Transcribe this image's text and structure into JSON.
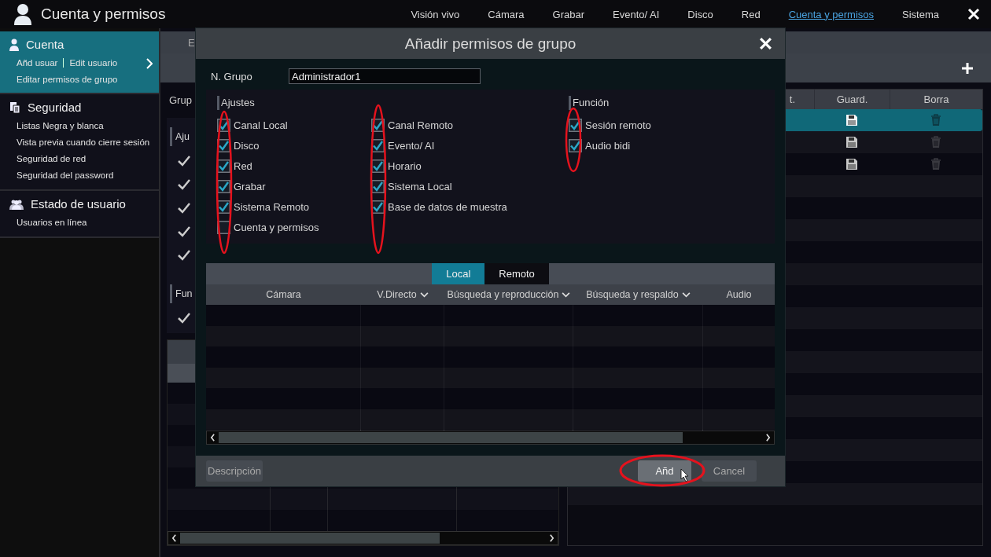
{
  "app": {
    "title": "Cuenta y permisos"
  },
  "nav": [
    {
      "label": "Visión vivo",
      "selected": false
    },
    {
      "label": "Cámara",
      "selected": false
    },
    {
      "label": "Grabar",
      "selected": false
    },
    {
      "label": "Evento/ AI",
      "selected": false
    },
    {
      "label": "Disco",
      "selected": false
    },
    {
      "label": "Red",
      "selected": false
    },
    {
      "label": "Cuenta y permisos",
      "selected": true
    },
    {
      "label": "Sistema",
      "selected": false
    }
  ],
  "sidebar": {
    "sections": [
      {
        "title": "Cuenta",
        "selected": true,
        "link_rows": [
          [
            "Añd usuar",
            "Edit usuario"
          ],
          [
            "Editar permisos de grupo"
          ]
        ]
      },
      {
        "title": "Seguridad",
        "selected": false,
        "link_rows": [
          [
            "Listas Negra y blanca"
          ],
          [
            "Vista previa cuando cierre sesión"
          ],
          [
            "Seguridad de red"
          ],
          [
            "Seguridad del password"
          ]
        ]
      },
      {
        "title": "Estado de usuario",
        "selected": false,
        "link_rows": [
          [
            "Usuarios en línea"
          ]
        ]
      }
    ]
  },
  "background": {
    "tab": "E",
    "group_label": "Grup",
    "settings_heading": "Aju",
    "function_heading": "Fun",
    "right_table": {
      "columns": [
        "t.",
        "Guard.",
        "Borra"
      ],
      "rows": [
        {
          "selected": true
        },
        {
          "selected": false
        },
        {
          "selected": false
        }
      ]
    }
  },
  "dialog": {
    "title": "Añadir permisos de grupo",
    "group_name_label": "N. Grupo",
    "group_name_value": "Administrador1",
    "permission_columns": [
      {
        "heading": "Ajustes",
        "items": [
          {
            "label": "Canal Local",
            "checked": true
          },
          {
            "label": "Disco",
            "checked": true
          },
          {
            "label": "Red",
            "checked": true
          },
          {
            "label": "Grabar",
            "checked": true
          },
          {
            "label": "Sistema Remoto",
            "checked": true
          },
          {
            "label": "Cuenta y permisos",
            "checked": false
          }
        ]
      },
      {
        "items": [
          {
            "label": "Canal Remoto",
            "checked": true
          },
          {
            "label": "Evento/ AI",
            "checked": true
          },
          {
            "label": "Horario",
            "checked": true
          },
          {
            "label": "Sistema Local",
            "checked": true
          },
          {
            "label": "Base de datos de muestra",
            "checked": true
          }
        ]
      },
      {
        "heading": "Función",
        "items": [
          {
            "label": "Sesión remoto",
            "checked": true
          },
          {
            "label": "Audio bidi",
            "checked": true
          }
        ]
      }
    ],
    "tabs": [
      {
        "label": "Local",
        "selected": true
      },
      {
        "label": "Remoto",
        "selected": false
      }
    ],
    "columns": [
      {
        "label": "Cámara",
        "dropdown": false
      },
      {
        "label": "V.Directo",
        "dropdown": true
      },
      {
        "label": "Búsqueda y reproducción",
        "dropdown": true
      },
      {
        "label": "Búsqueda y respaldo",
        "dropdown": true
      },
      {
        "label": "Audio",
        "dropdown": false
      }
    ],
    "left_button": "Descripción",
    "buttons": [
      {
        "label": "Añd",
        "primary": true
      },
      {
        "label": "Cancel",
        "primary": false
      }
    ]
  }
}
